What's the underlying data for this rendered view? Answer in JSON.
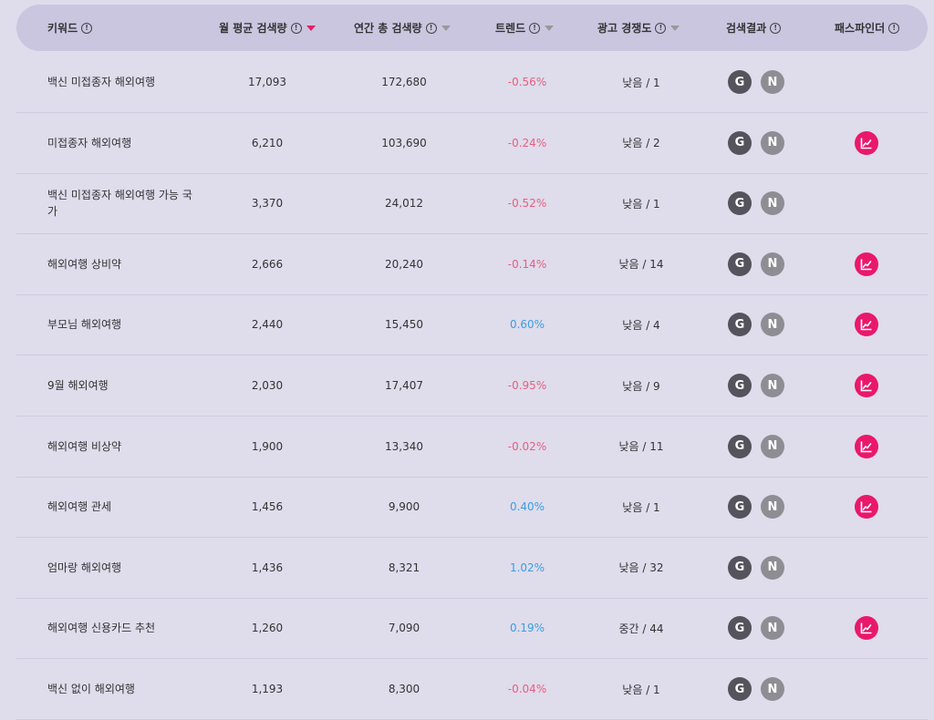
{
  "columns": {
    "keyword": "키워드",
    "monthly": "월 평균 검색량",
    "yearly": "연간 총 검색량",
    "trend": "트렌드",
    "ad": "광고 경쟁도",
    "results": "검색결과",
    "pathfinder": "패스파인더"
  },
  "info_glyph": "!",
  "badges": {
    "google": "G",
    "naver": "N"
  },
  "colors": {
    "negative": "#e5607f",
    "positive": "#3a9ee0",
    "pathfinder": "#e9186b",
    "sort_active": "#e91e63"
  },
  "rows": [
    {
      "keyword": "백신 미접종자 해외여행",
      "monthly": "17,093",
      "yearly": "172,680",
      "trend": "-0.56%",
      "trend_dir": "neg",
      "ad": "낮음 / 1",
      "pathfinder": false
    },
    {
      "keyword": "미접종자 해외여행",
      "monthly": "6,210",
      "yearly": "103,690",
      "trend": "-0.24%",
      "trend_dir": "neg",
      "ad": "낮음 / 2",
      "pathfinder": true
    },
    {
      "keyword": "백신 미접종자 해외여행 가능 국가",
      "monthly": "3,370",
      "yearly": "24,012",
      "trend": "-0.52%",
      "trend_dir": "neg",
      "ad": "낮음 / 1",
      "pathfinder": false
    },
    {
      "keyword": "해외여행 상비약",
      "monthly": "2,666",
      "yearly": "20,240",
      "trend": "-0.14%",
      "trend_dir": "neg",
      "ad": "낮음 / 14",
      "pathfinder": true
    },
    {
      "keyword": "부모님 해외여행",
      "monthly": "2,440",
      "yearly": "15,450",
      "trend": "0.60%",
      "trend_dir": "pos",
      "ad": "낮음 / 4",
      "pathfinder": true
    },
    {
      "keyword": "9월 해외여행",
      "monthly": "2,030",
      "yearly": "17,407",
      "trend": "-0.95%",
      "trend_dir": "neg",
      "ad": "낮음 / 9",
      "pathfinder": true
    },
    {
      "keyword": "해외여행 비상약",
      "monthly": "1,900",
      "yearly": "13,340",
      "trend": "-0.02%",
      "trend_dir": "neg",
      "ad": "낮음 / 11",
      "pathfinder": true
    },
    {
      "keyword": "해외여행 관세",
      "monthly": "1,456",
      "yearly": "9,900",
      "trend": "0.40%",
      "trend_dir": "pos",
      "ad": "낮음 / 1",
      "pathfinder": true
    },
    {
      "keyword": "엄마랑 해외여행",
      "monthly": "1,436",
      "yearly": "8,321",
      "trend": "1.02%",
      "trend_dir": "pos",
      "ad": "낮음 / 32",
      "pathfinder": false
    },
    {
      "keyword": "해외여행 신용카드 추천",
      "monthly": "1,260",
      "yearly": "7,090",
      "trend": "0.19%",
      "trend_dir": "pos",
      "ad": "중간 / 44",
      "pathfinder": true
    },
    {
      "keyword": "백신 없이 해외여행",
      "monthly": "1,193",
      "yearly": "8,300",
      "trend": "-0.04%",
      "trend_dir": "neg",
      "ad": "낮음 / 1",
      "pathfinder": false
    }
  ]
}
